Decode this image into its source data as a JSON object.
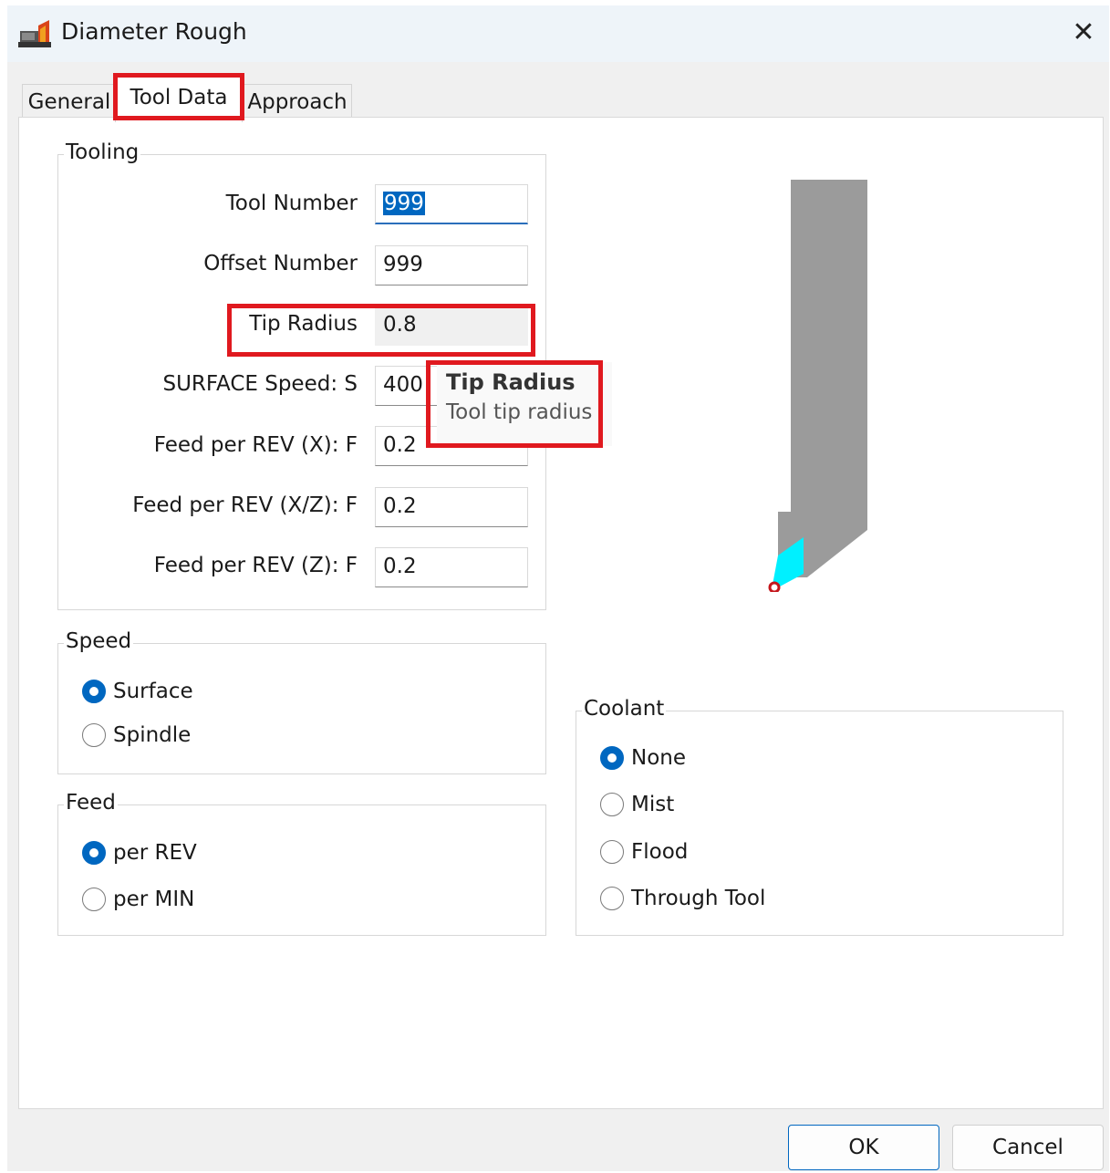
{
  "window": {
    "title": "Diameter Rough",
    "close_glyph": "✕"
  },
  "tabs": [
    {
      "label": "General",
      "active": false
    },
    {
      "label": "Tool Data",
      "active": true
    },
    {
      "label": "Approach",
      "active": false
    }
  ],
  "tooling": {
    "legend": "Tooling",
    "fields": [
      {
        "label": "Tool Number",
        "value": "999"
      },
      {
        "label": "Offset Number",
        "value": "999"
      },
      {
        "label": "Tip Radius",
        "value": "0.8"
      },
      {
        "label": "SURFACE Speed: S",
        "value": "400"
      },
      {
        "label": "Feed per REV (X): F",
        "value": "0.2"
      },
      {
        "label": "Feed per REV (X/Z): F",
        "value": "0.2"
      },
      {
        "label": "Feed per REV (Z): F",
        "value": "0.2"
      }
    ]
  },
  "tooltip": {
    "title": "Tip Radius",
    "body": "Tool tip radius"
  },
  "speed": {
    "legend": "Speed",
    "options": [
      "Surface",
      "Spindle"
    ],
    "selected": "Surface"
  },
  "feed": {
    "legend": "Feed",
    "options": [
      "per REV",
      "per MIN"
    ],
    "selected": "per REV"
  },
  "coolant": {
    "legend": "Coolant",
    "options": [
      "None",
      "Mist",
      "Flood",
      "Through Tool"
    ],
    "selected": "None"
  },
  "buttons": {
    "ok": "OK",
    "cancel": "Cancel"
  },
  "colors": {
    "highlight": "#e0191f",
    "accent": "#0067c0",
    "tool_body": "#9b9b9b",
    "tool_insert": "#00f0ff"
  }
}
